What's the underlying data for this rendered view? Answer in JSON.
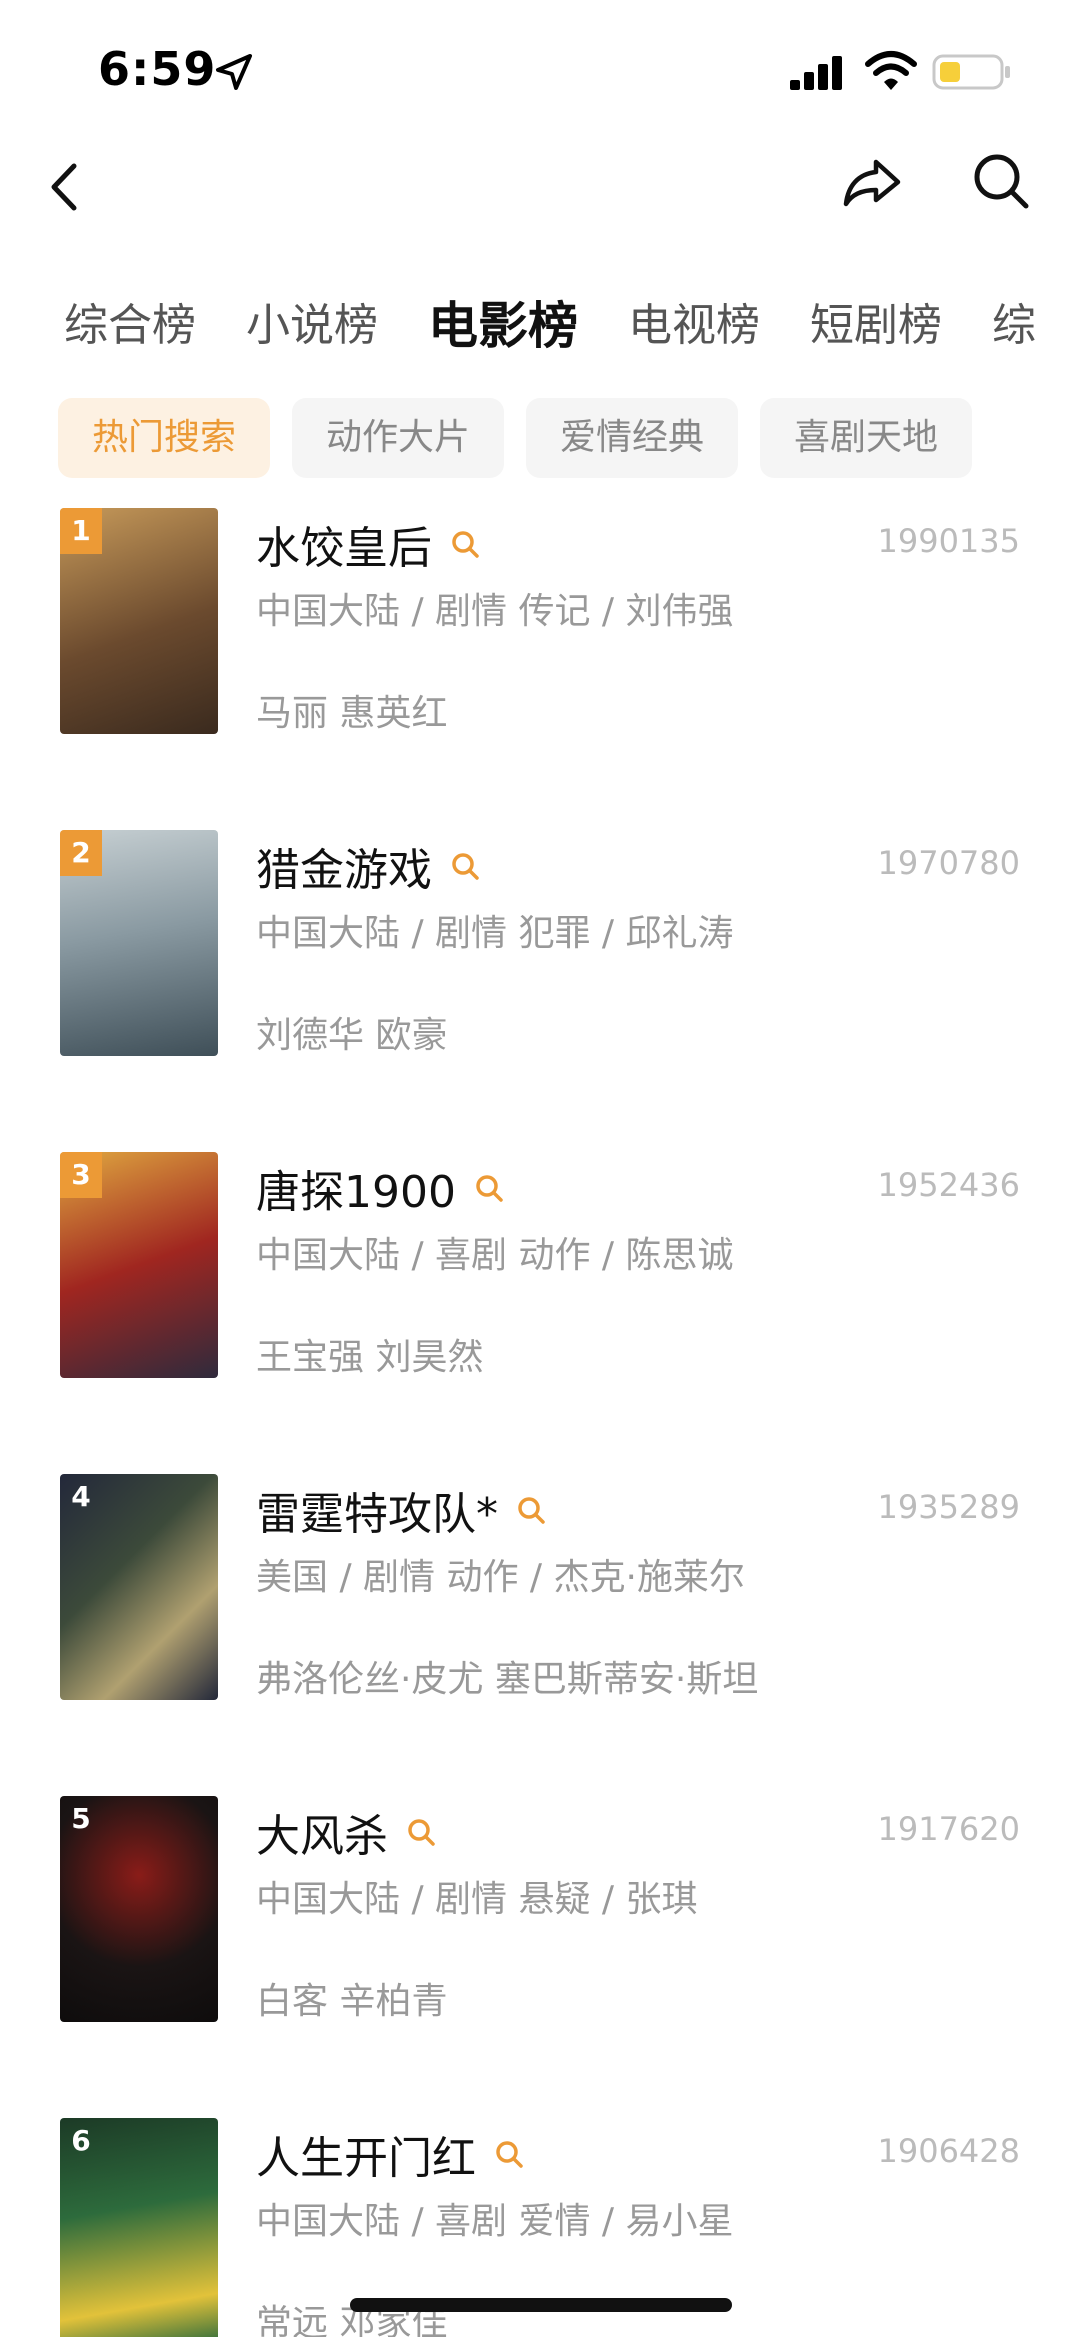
{
  "status_bar": {
    "time": "6:59"
  },
  "category_tabs": [
    {
      "label": "综合榜",
      "active": false
    },
    {
      "label": "小说榜",
      "active": false
    },
    {
      "label": "电影榜",
      "active": true
    },
    {
      "label": "电视榜",
      "active": false
    },
    {
      "label": "短剧榜",
      "active": false
    },
    {
      "label": "综",
      "active": false
    }
  ],
  "sub_filters": [
    {
      "label": "热门搜索",
      "active": true
    },
    {
      "label": "动作大片",
      "active": false
    },
    {
      "label": "爱情经典",
      "active": false
    },
    {
      "label": "喜剧天地",
      "active": false
    }
  ],
  "items": [
    {
      "rank": "1",
      "title": "水饺皇后",
      "count": "1990135",
      "meta": "中国大陆 / 剧情 传记 / 刘伟强",
      "cast": "马丽 惠英红",
      "poster_colors": [
        "#6b4a2e",
        "#c79a5a",
        "#3a2a1e"
      ]
    },
    {
      "rank": "2",
      "title": "猎金游戏",
      "count": "1970780",
      "meta": "中国大陆 / 剧情 犯罪 / 邱礼涛",
      "cast": "刘德华 欧豪",
      "poster_colors": [
        "#8a9aa2",
        "#c6cfd2",
        "#3f4f58"
      ]
    },
    {
      "rank": "3",
      "title": "唐探1900",
      "count": "1952436",
      "meta": "中国大陆 / 喜剧 动作 / 陈思诚",
      "cast": "王宝强 刘昊然",
      "poster_colors": [
        "#a02620",
        "#e0a840",
        "#2f2a3c"
      ]
    },
    {
      "rank": "4",
      "title": "雷霆特攻队*",
      "count": "1935289",
      "meta": "美国 / 剧情 动作 / 杰克·施莱尔",
      "cast": "弗洛伦丝·皮尤 塞巴斯蒂安·斯坦",
      "poster_colors": [
        "#3c4a3a",
        "#b0a070",
        "#23283a"
      ]
    },
    {
      "rank": "5",
      "title": "大风杀",
      "count": "1917620",
      "meta": "中国大陆 / 剧情 悬疑 / 张琪",
      "cast": "白客 辛柏青",
      "poster_colors": [
        "#1a1414",
        "#8a1c18",
        "#0e0c0c"
      ]
    },
    {
      "rank": "6",
      "title": "人生开门红",
      "count": "1906428",
      "meta": "中国大陆 / 喜剧 爱情 / 易小星",
      "cast": "常远 邓家佳",
      "poster_colors": [
        "#2d6b3c",
        "#e2c23a",
        "#1c3a26"
      ]
    }
  ],
  "colors": {
    "accent": "#ec9a36",
    "accent_bg": "#fdf1e2"
  }
}
